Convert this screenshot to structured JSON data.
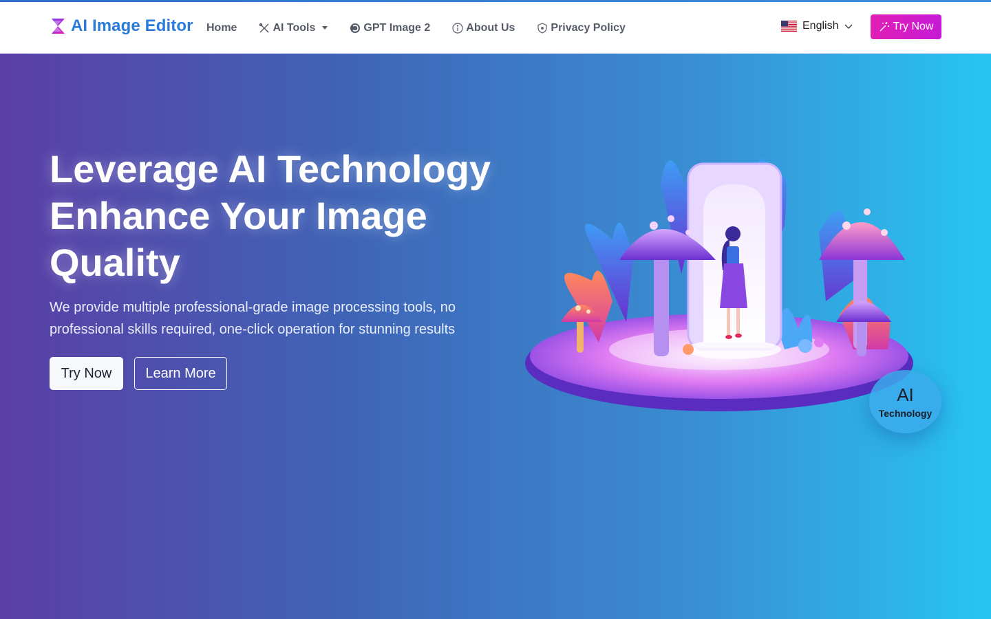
{
  "brand": {
    "name": "AI Image Editor"
  },
  "nav": {
    "items": [
      {
        "label": "Home",
        "icon": ""
      },
      {
        "label": "AI Tools",
        "icon": "tools-icon",
        "has_dropdown": true
      },
      {
        "label": "GPT Image 2",
        "icon": "openai-icon"
      },
      {
        "label": "About Us",
        "icon": "info-icon"
      },
      {
        "label": "Privacy Policy",
        "icon": "shield-icon"
      }
    ]
  },
  "language": {
    "selected": "English",
    "flag": "us-flag-icon"
  },
  "header_cta": {
    "label": "Try Now",
    "icon": "magic-wand-icon"
  },
  "hero": {
    "headline": [
      "Leverage AI Technology",
      "Enhance Your Image",
      "Quality"
    ],
    "subtitle": "We provide multiple professional-grade image processing tools, no professional skills required, one-click operation for stunning results",
    "primary_button": "Try Now",
    "secondary_button": "Learn More",
    "badge": {
      "title": "AI",
      "subtitle": "Technology"
    }
  },
  "colors": {
    "brand": "#2b7bd8",
    "cta": "#d21cc6",
    "hero_gradient_start": "#5b3fa6",
    "hero_gradient_end": "#27c5f2"
  }
}
